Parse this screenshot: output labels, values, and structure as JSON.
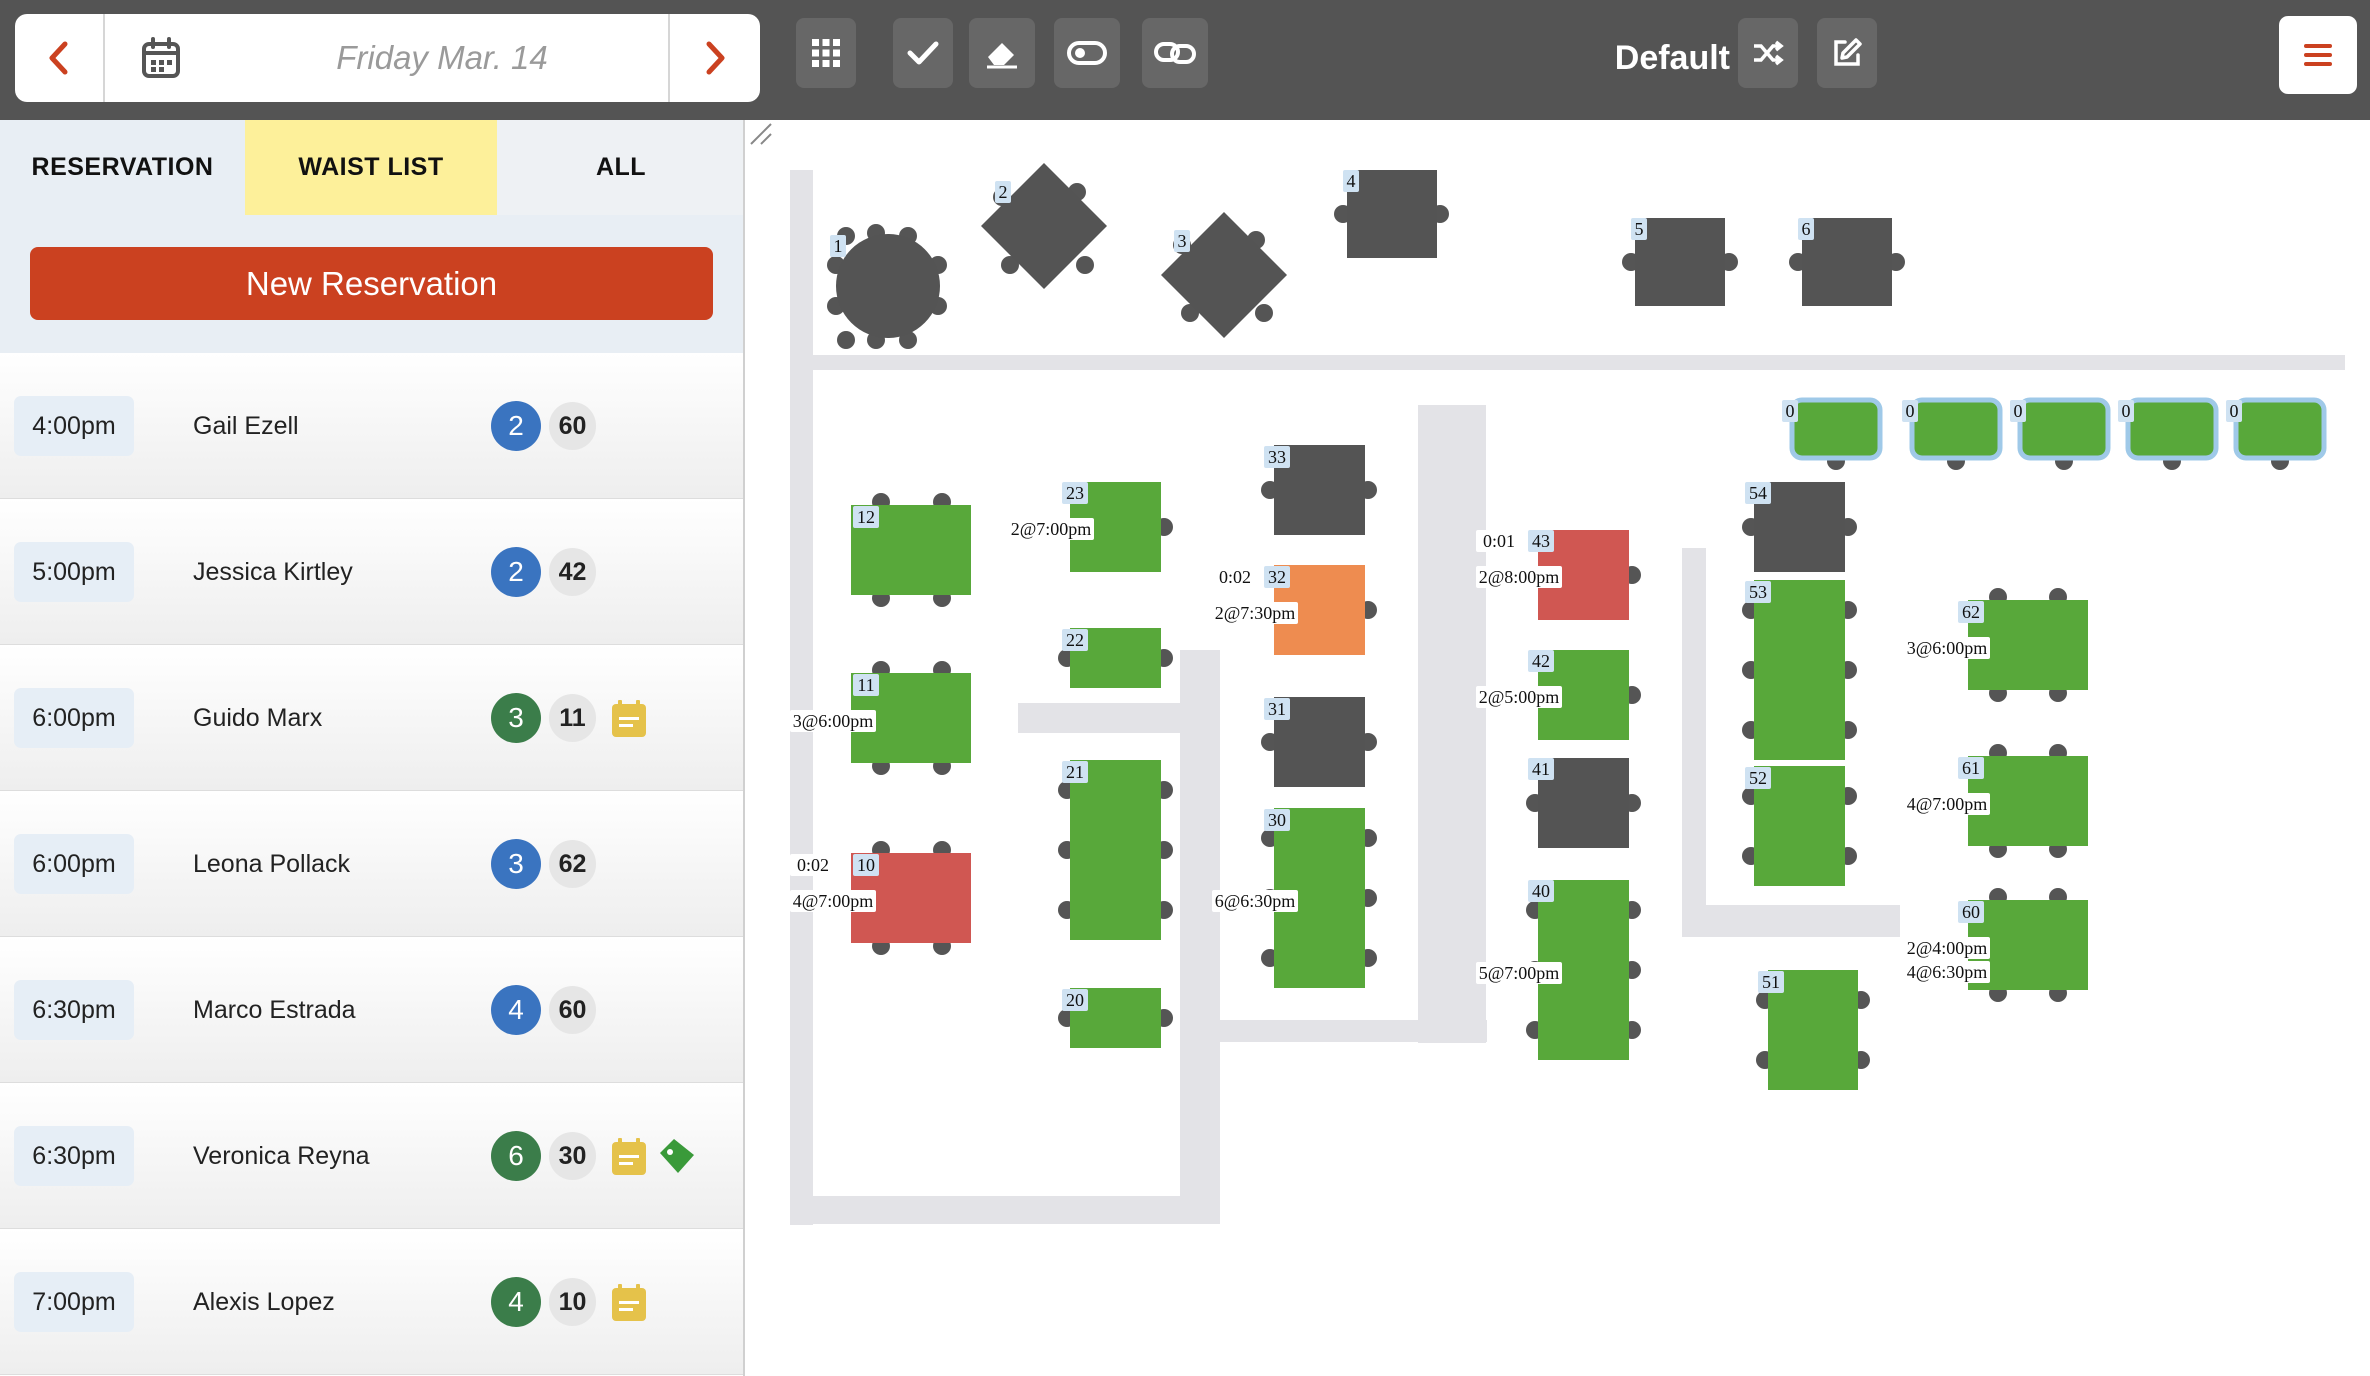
{
  "header": {
    "date": "Friday Mar. 14",
    "layout_name": "Default",
    "colors": {
      "bar": "#545454",
      "accent": "#cb4120",
      "tool": "#676767"
    },
    "icons": [
      "chevron-left-icon",
      "calendar-icon",
      "chevron-right-icon",
      "grid-icon",
      "check-icon",
      "eraser-icon",
      "toggle-icon",
      "link-icon",
      "shuffle-icon",
      "edit-icon",
      "menu-icon"
    ]
  },
  "sidebar": {
    "tabs": [
      {
        "label": "RESERVATION"
      },
      {
        "label": "WAIST LIST"
      },
      {
        "label": "ALL"
      }
    ],
    "new_reservation_label": "New Reservation",
    "reservations": [
      {
        "time": "4:00pm",
        "name": "Gail Ezell",
        "party": "2",
        "party_color": "#3a74c0",
        "table": "60",
        "note": false,
        "tag": false
      },
      {
        "time": "5:00pm",
        "name": "Jessica Kirtley",
        "party": "2",
        "party_color": "#3a74c0",
        "table": "42",
        "note": false,
        "tag": false
      },
      {
        "time": "6:00pm",
        "name": "Guido Marx",
        "party": "3",
        "party_color": "#3b7d4a",
        "table": "11",
        "note": true,
        "tag": false
      },
      {
        "time": "6:00pm",
        "name": "Leona Pollack",
        "party": "3",
        "party_color": "#3a74c0",
        "table": "62",
        "note": false,
        "tag": false
      },
      {
        "time": "6:30pm",
        "name": "Marco Estrada",
        "party": "4",
        "party_color": "#3a74c0",
        "table": "60",
        "note": false,
        "tag": false
      },
      {
        "time": "6:30pm",
        "name": "Veronica Reyna",
        "party": "6",
        "party_color": "#3b7d4a",
        "table": "30",
        "note": true,
        "tag": true
      },
      {
        "time": "7:00pm",
        "name": "Alexis Lopez",
        "party": "4",
        "party_color": "#3b7d4a",
        "table": "10",
        "note": true,
        "tag": false
      }
    ]
  },
  "floor": {
    "colors": {
      "available": "#58a83a",
      "occupied": "#545454",
      "late": "#d05752",
      "warning": "#ee8c50",
      "wall": "#e3e3e7"
    },
    "tables": [
      {
        "number": "1",
        "status": "occupied"
      },
      {
        "number": "2",
        "status": "occupied"
      },
      {
        "number": "3",
        "status": "occupied"
      },
      {
        "number": "4",
        "status": "occupied"
      },
      {
        "number": "5",
        "status": "occupied"
      },
      {
        "number": "6",
        "status": "occupied"
      },
      {
        "number": "12",
        "status": "available"
      },
      {
        "number": "11",
        "status": "available",
        "reservations": [
          "3@6:00pm"
        ]
      },
      {
        "number": "10",
        "status": "late",
        "timer": "0:02",
        "reservations": [
          "4@7:00pm"
        ]
      },
      {
        "number": "23",
        "status": "available",
        "reservations": [
          "2@7:00pm"
        ]
      },
      {
        "number": "22",
        "status": "available"
      },
      {
        "number": "21",
        "status": "available"
      },
      {
        "number": "20",
        "status": "available"
      },
      {
        "number": "33",
        "status": "occupied"
      },
      {
        "number": "32",
        "status": "warning",
        "timer": "0:02",
        "reservations": [
          "2@7:30pm"
        ]
      },
      {
        "number": "31",
        "status": "occupied"
      },
      {
        "number": "30",
        "status": "available",
        "reservations": [
          "6@6:30pm"
        ]
      },
      {
        "number": "43",
        "status": "late",
        "timer": "0:01",
        "reservations": [
          "2@8:00pm"
        ]
      },
      {
        "number": "42",
        "status": "available",
        "reservations": [
          "2@5:00pm"
        ]
      },
      {
        "number": "41",
        "status": "occupied"
      },
      {
        "number": "40",
        "status": "available",
        "reservations": [
          "5@7:00pm"
        ]
      },
      {
        "number": "54",
        "status": "occupied"
      },
      {
        "number": "53",
        "status": "available"
      },
      {
        "number": "52",
        "status": "available"
      },
      {
        "number": "51",
        "status": "available"
      },
      {
        "number": "62",
        "status": "available",
        "reservations": [
          "3@6:00pm"
        ]
      },
      {
        "number": "61",
        "status": "available",
        "reservations": [
          "4@7:00pm"
        ]
      },
      {
        "number": "60",
        "status": "available",
        "reservations": [
          "2@4:00pm",
          "4@6:30pm"
        ]
      },
      {
        "number": "0",
        "status": "available",
        "selected": true
      },
      {
        "number": "0",
        "status": "available",
        "selected": true
      },
      {
        "number": "0",
        "status": "available",
        "selected": true
      },
      {
        "number": "0",
        "status": "available",
        "selected": true
      },
      {
        "number": "0",
        "status": "available",
        "selected": true
      }
    ]
  }
}
